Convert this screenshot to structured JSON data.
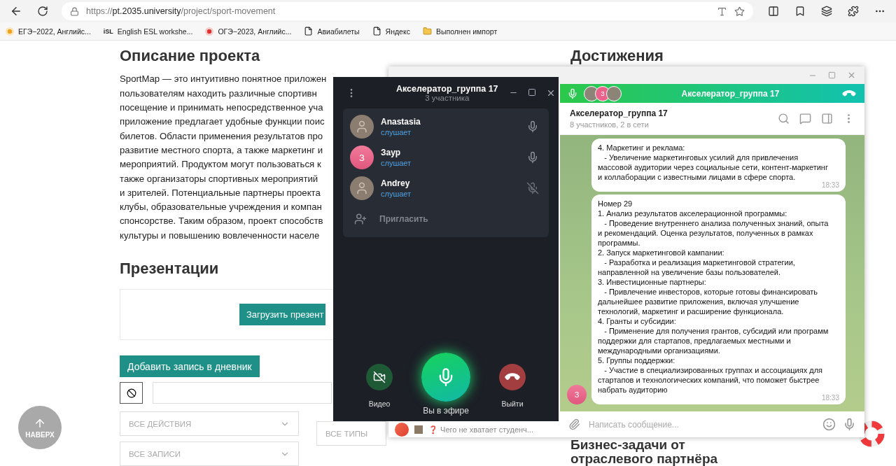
{
  "browser": {
    "url_scheme": "https://",
    "url_host": "pt.2035.university",
    "url_path": "/project/sport-movement",
    "bookmarks": [
      {
        "kind": "orange",
        "label": "ЕГЭ−2022, Английс..."
      },
      {
        "kind": "logo",
        "badge": "iSL",
        "label": "English ESL workshe..."
      },
      {
        "kind": "red",
        "label": "ОГЭ−2023, Английс..."
      },
      {
        "kind": "page",
        "label": "Авиабилеты"
      },
      {
        "kind": "page",
        "label": "Яндекс"
      },
      {
        "kind": "folder",
        "label": "Выполнен импорт"
      }
    ]
  },
  "page": {
    "description": {
      "title": "Описание проекта",
      "lines": [
        "SportMap — это интуитивно понятное приложен",
        "пользователям находить различные спортивн",
        "посещение и принимать непосредственное уча",
        "приложение предлагает удобные функции поис",
        "билетов. Области применения результатов про",
        "развитие местного спорта, а также маркетинг и",
        "мероприятий. Продуктом могут пользоваться к",
        "также организаторы спортивных мероприятий",
        "и зрителей. Потенциальные партнеры проекта",
        "клубы, образовательные учреждения и компан",
        "спонсорстве. Таким образом, проект способств",
        "культуры и повышению вовлеченности населе"
      ]
    },
    "presentations": {
      "title": "Презентации",
      "upload_button": "Загрузить презент"
    },
    "add_entry_button": "Добавить запись в дневник",
    "filters": [
      {
        "label": "ВСЕ ДЕЙСТВИЯ",
        "chevron": true
      },
      {
        "label": "ВСЕ ТИПЫ",
        "chevron": false
      },
      {
        "label": "ВСЕ ЗАПИСИ",
        "chevron": true
      }
    ],
    "achievements_title": "Достижения",
    "business_title_lines": [
      "Бизнес-задачи от",
      "отраслевого партнёра"
    ],
    "scroll_top": "НАВЕРХ"
  },
  "telegram": {
    "call_bar": {
      "title": "Акселератор_группа 17",
      "avatars": [
        {
          "kind": "photo"
        },
        {
          "kind": "letter",
          "letter": "З"
        },
        {
          "kind": "photo"
        }
      ]
    },
    "chat": {
      "title": "Акселератор_группа 17",
      "subtitle": "8 участников, 2 в сети"
    },
    "messages": [
      {
        "text": "4. Маркетинг и реклама:\n   - Увеличение маркетинговых усилий для привлечения\nмассовой аудитории через социальные сети, контент-маркетинг\nи коллаборации с известными лицами в сфере спорта.",
        "time": "18:33"
      },
      {
        "text": "Номер 29\n1. Анализ результатов акселерационной программы:\n   - Проведение внутреннего анализа полученных знаний, опыта\nи рекомендаций. Оценка результатов, полученных в рамках\nпрограммы.\n2. Запуск маркетинговой кампании:\n   - Разработка и реализация маркетинговой стратегии,\nнаправленной на увеличение базы пользователей.\n3. Инвестиционные партнеры:\n   - Привлечение инвесторов, которые готовы финансировать\nдальнейшее развитие приложения, включая улучшение\nтехнологий, маркетинг и расширение функционала.\n4. Гранты и субсидии:\n   - Применение для получения грантов, субсидий или программ\nподдержки для стартапов, предлагаемых местными и\nмеждународными организациями.\n5. Группы поддержки:\n   - Участие в специализированных группах и ассоциациях для\nстартапов и технологических компаний, что поможет быстрее\nнабрать аудиторию",
        "time": "18:33",
        "avatar_letter": "З"
      }
    ],
    "composer_placeholder": "Написать сообщение...",
    "chat_preview": "❓ Чего не хватает студенч..."
  },
  "call": {
    "title": "Акселератор_группа 17",
    "subtitle": "3 участника",
    "participants": [
      {
        "name": "Anastasia",
        "status": "слушает",
        "kind": "photo",
        "muted": false
      },
      {
        "name": "Заур",
        "status": "слушает",
        "kind": "letter",
        "letter": "З",
        "muted": false
      },
      {
        "name": "Andrey",
        "status": "слушает",
        "kind": "photo",
        "muted": true
      }
    ],
    "invite": "Пригласить",
    "controls": [
      {
        "kind": "video",
        "label": "Видео"
      },
      {
        "kind": "mic",
        "label": "Вы в эфире"
      },
      {
        "kind": "leave",
        "label": "Выйти"
      }
    ]
  }
}
